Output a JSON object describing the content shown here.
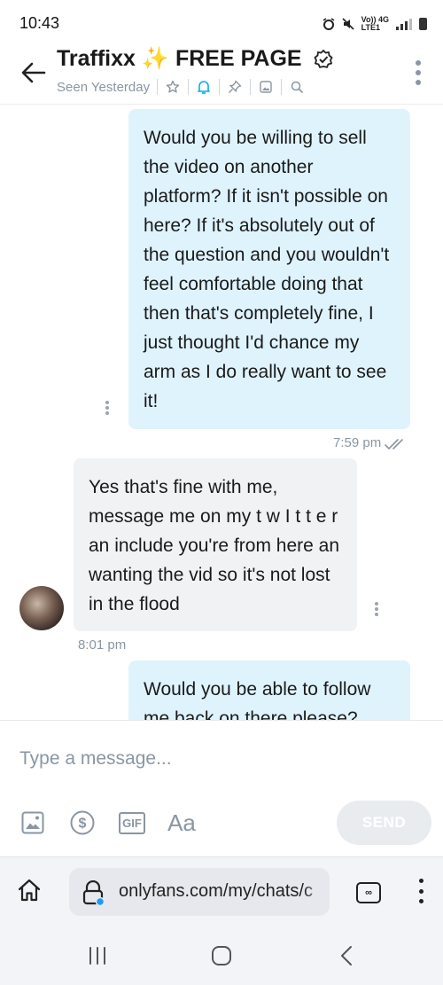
{
  "status_bar": {
    "time": "10:43",
    "network_label": "Vo)) 4G",
    "network_sub": "LTE1"
  },
  "header": {
    "title": "Traffixx ✨ FREE PAGE",
    "seen": "Seen Yesterday",
    "icons": [
      "star-icon",
      "bell-icon",
      "pin-icon",
      "image-icon",
      "search-icon"
    ],
    "accent_color": "#00aff0"
  },
  "messages": [
    {
      "direction": "outgoing",
      "text": "Would you be willing to sell the video on another platform? If it isn't possible on here? If it's absolutely out of the question and you wouldn't feel comfortable doing that then that's completely fine, I just thought I'd chance my arm as I do really want to see it!",
      "time": "7:59 pm",
      "read": true
    },
    {
      "direction": "incoming",
      "text": "Yes that's fine with me, message me on my t w I t t e r an include you're from here an wanting the vid so it's not lost in the flood",
      "time": "8:01 pm"
    },
    {
      "direction": "outgoing",
      "text": "Would you be able to follow me back on there please?"
    }
  ],
  "composer": {
    "placeholder": "Type a message...",
    "gif_label": "GIF",
    "text_format_label": "Aa",
    "send_label": "SEND"
  },
  "browser": {
    "url": "onlyfans.com/my/chats/c",
    "tabs_label": "∞"
  }
}
